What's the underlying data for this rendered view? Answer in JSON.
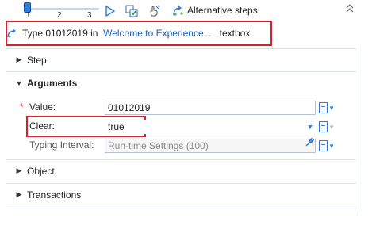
{
  "toolbar": {
    "slider_ticks": [
      "1",
      "2",
      "3"
    ],
    "slider_value": 1,
    "slider_max": 3,
    "alt_steps_label": "Alternative steps",
    "icons": [
      "play-icon",
      "capture-icon",
      "hand-pointer-icon",
      "alternative-steps-icon",
      "collapse-icon"
    ]
  },
  "step": {
    "type_label": "Type",
    "value": "01012019",
    "in_label": "in",
    "target_link": "Welcome to Experience...",
    "target_kind": "textbox"
  },
  "sections": {
    "step": "Step",
    "arguments": "Arguments",
    "object": "Object",
    "transactions": "Transactions"
  },
  "arguments": {
    "value": {
      "label": "Value:",
      "required_marker": "*",
      "field_value": "01012019"
    },
    "clear": {
      "label": "Clear:",
      "field_value": "true"
    },
    "typing_interval": {
      "label": "Typing Interval:",
      "field_value": "Run-time Settings (100)"
    }
  },
  "colors": {
    "highlight": "#d9202c",
    "link": "#1a5fb4",
    "accent": "#2f7fdd"
  }
}
